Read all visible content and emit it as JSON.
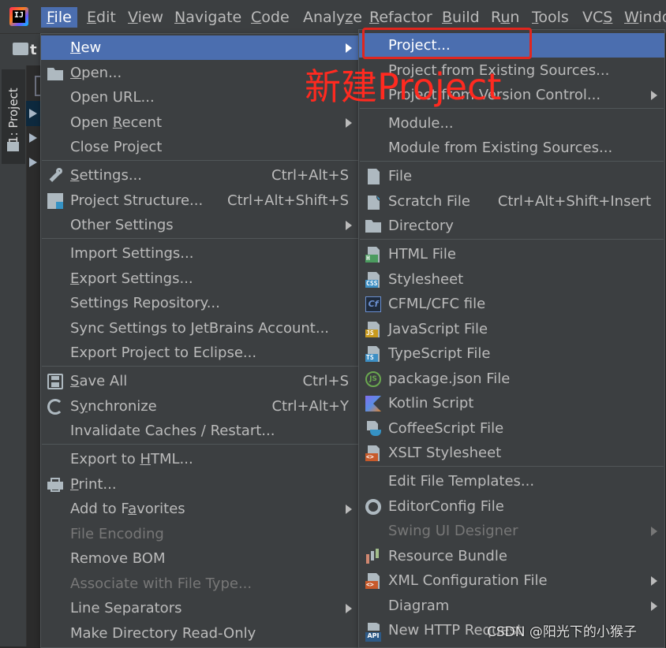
{
  "menubar": {
    "items": [
      {
        "mnemonic": "F",
        "rest": "ile"
      },
      {
        "mnemonic": "E",
        "rest": "dit"
      },
      {
        "mnemonic": "V",
        "rest": "iew"
      },
      {
        "mnemonic": "N",
        "rest": "avigate"
      },
      {
        "mnemonic": "C",
        "rest": "ode"
      },
      {
        "pre": "Analy",
        "mnemonic": "z",
        "rest": "e"
      },
      {
        "mnemonic": "R",
        "rest": "efactor"
      },
      {
        "mnemonic": "B",
        "rest": "uild"
      },
      {
        "pre": "R",
        "mnemonic": "u",
        "rest": "n"
      },
      {
        "mnemonic": "T",
        "rest": "ools"
      },
      {
        "pre": "VC",
        "mnemonic": "S",
        "rest": ""
      },
      {
        "mnemonic": "W",
        "rest": "indo"
      }
    ],
    "app_logo_text": "IJ"
  },
  "left_panel": {
    "tool_window_label": "1: Project",
    "project_name_fragment": "t"
  },
  "file_menu": {
    "items": [
      {
        "pre": "",
        "mn": "N",
        "rest": "ew",
        "shortcut": "",
        "submenu": true
      },
      {
        "pre": "",
        "mn": "O",
        "rest": "pen...",
        "shortcut": "",
        "icon": "folder-open-icon"
      },
      {
        "pre": "Open URL...",
        "mn": "",
        "rest": "",
        "shortcut": ""
      },
      {
        "pre": "Open ",
        "mn": "R",
        "rest": "ecent",
        "shortcut": "",
        "submenu": true
      },
      {
        "pre": "Close Project",
        "mn": "",
        "rest": "",
        "shortcut": ""
      },
      {
        "pre": "",
        "mn": "S",
        "rest": "ettings...",
        "shortcut": "Ctrl+Alt+S",
        "icon": "wrench-icon"
      },
      {
        "pre": "Project Structure...",
        "mn": "",
        "rest": "",
        "shortcut": "Ctrl+Alt+Shift+S",
        "icon": "project-structure-icon"
      },
      {
        "pre": "Other Settings",
        "mn": "",
        "rest": "",
        "shortcut": "",
        "submenu": true
      },
      {
        "pre": "Import Settings...",
        "mn": "",
        "rest": "",
        "shortcut": ""
      },
      {
        "pre": "",
        "mn": "E",
        "rest": "xport Settings...",
        "shortcut": ""
      },
      {
        "pre": "Settings Repository...",
        "mn": "",
        "rest": "",
        "shortcut": ""
      },
      {
        "pre": "Sync Settings to JetBrains Account...",
        "mn": "",
        "rest": "",
        "shortcut": ""
      },
      {
        "pre": "Export Project to Eclipse...",
        "mn": "",
        "rest": "",
        "shortcut": ""
      },
      {
        "pre": "",
        "mn": "S",
        "rest": "ave All",
        "shortcut": "Ctrl+S",
        "icon": "save-icon"
      },
      {
        "pre": "S",
        "mn": "y",
        "rest": "nchronize",
        "shortcut": "Ctrl+Alt+Y",
        "icon": "sync-icon"
      },
      {
        "pre": "Invalidate Caches / Restart...",
        "mn": "",
        "rest": "",
        "shortcut": ""
      },
      {
        "pre": "Export to ",
        "mn": "H",
        "rest": "TML...",
        "shortcut": ""
      },
      {
        "pre": "",
        "mn": "P",
        "rest": "rint...",
        "shortcut": "",
        "icon": "printer-icon"
      },
      {
        "pre": "Add to F",
        "mn": "a",
        "rest": "vorites",
        "shortcut": "",
        "submenu": true
      },
      {
        "pre": "File Encoding",
        "mn": "",
        "rest": "",
        "shortcut": "",
        "disabled": true
      },
      {
        "pre": "Remove BOM",
        "mn": "",
        "rest": "",
        "shortcut": ""
      },
      {
        "pre": "Associate with File Type...",
        "mn": "",
        "rest": "",
        "shortcut": "",
        "disabled": true
      },
      {
        "pre": "Line Separators",
        "mn": "",
        "rest": "",
        "shortcut": "",
        "submenu": true
      },
      {
        "pre": "Make Directory Read-Only",
        "mn": "",
        "rest": "",
        "shortcut": ""
      }
    ]
  },
  "new_submenu": {
    "items": [
      {
        "label": "Project...",
        "shortcut": ""
      },
      {
        "label": "Project from Existing Sources...",
        "shortcut": ""
      },
      {
        "label": "Project from Version Control...",
        "shortcut": "",
        "submenu": true
      },
      {
        "label": "Module...",
        "shortcut": ""
      },
      {
        "label": "Module from Existing Sources...",
        "shortcut": ""
      },
      {
        "label": "File",
        "shortcut": "",
        "icon": "file-icon"
      },
      {
        "label": "Scratch File",
        "shortcut": "Ctrl+Alt+Shift+Insert",
        "icon": "scratch-file-icon"
      },
      {
        "label": "Directory",
        "shortcut": "",
        "icon": "directory-icon"
      },
      {
        "label": "HTML File",
        "shortcut": "",
        "icon": "html-file-icon",
        "badge": "H",
        "badge_color": "#4b9b5f"
      },
      {
        "label": "Stylesheet",
        "shortcut": "",
        "icon": "css-file-icon",
        "badge": "CSS",
        "badge_color": "#3d8fc4"
      },
      {
        "label": "CFML/CFC file",
        "shortcut": "",
        "icon": "cfml-file-icon",
        "badge": "Cf"
      },
      {
        "label": "JavaScript File",
        "shortcut": "",
        "icon": "javascript-file-icon",
        "badge": "JS",
        "badge_color": "#c99a1e"
      },
      {
        "label": "TypeScript File",
        "shortcut": "",
        "icon": "typescript-file-icon",
        "badge": "TS",
        "badge_color": "#3d8fc4"
      },
      {
        "label": "package.json File",
        "shortcut": "",
        "icon": "nodejs-icon",
        "badge": "JS"
      },
      {
        "label": "Kotlin Script",
        "shortcut": "",
        "icon": "kotlin-icon"
      },
      {
        "label": "CoffeeScript File",
        "shortcut": "",
        "icon": "coffeescript-icon"
      },
      {
        "label": "XSLT Stylesheet",
        "shortcut": "",
        "icon": "xslt-file-icon",
        "badge": "<>",
        "badge_color": "#c75a2b"
      },
      {
        "label": "Edit File Templates...",
        "shortcut": ""
      },
      {
        "label": "EditorConfig File",
        "shortcut": "",
        "icon": "gear-icon"
      },
      {
        "label": "Swing UI Designer",
        "shortcut": "",
        "submenu": true,
        "disabled": true
      },
      {
        "label": "Resource Bundle",
        "shortcut": "",
        "icon": "resource-bundle-icon"
      },
      {
        "label": "XML Configuration File",
        "shortcut": "",
        "submenu": true,
        "icon": "xml-file-icon",
        "badge": "<>",
        "badge_color": "#c75a2b"
      },
      {
        "label": "Diagram",
        "shortcut": "",
        "submenu": true
      },
      {
        "label": "New HTTP Request",
        "shortcut": "",
        "icon": "api-icon",
        "badge": "API"
      }
    ]
  },
  "annotation": {
    "text": "新建Project",
    "color": "#ff2a20"
  },
  "watermark": {
    "text": "CSDN @阳光下的小猴子"
  },
  "colors": {
    "selection": "#4b6eaf",
    "menu_bg": "#3c3f41",
    "annotation_red": "#e0261e"
  }
}
